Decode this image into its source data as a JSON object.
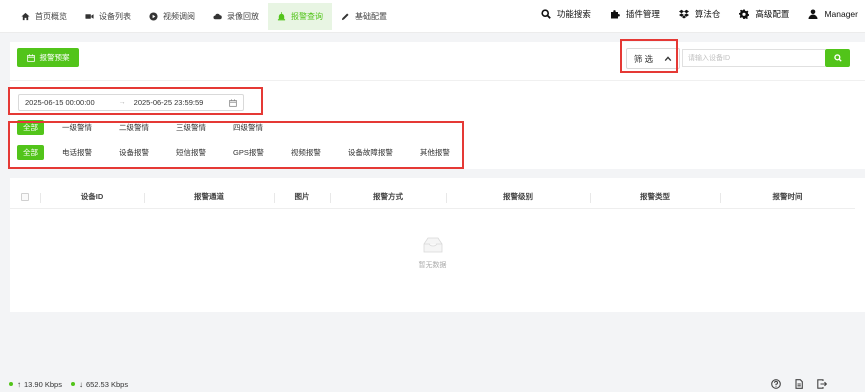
{
  "nav": {
    "items": [
      {
        "label": "首页概览",
        "icon": "home-icon"
      },
      {
        "label": "设备列表",
        "icon": "camera-icon"
      },
      {
        "label": "视频调阅",
        "icon": "video-icon"
      },
      {
        "label": "录像回放",
        "icon": "cloud-icon"
      },
      {
        "label": "报警查询",
        "icon": "alarm-icon"
      },
      {
        "label": "基础配置",
        "icon": "edit-icon"
      }
    ],
    "active": "报警查询"
  },
  "tools": {
    "function_search": "功能搜索",
    "plugin_manage": "插件管理",
    "algorithm_store": "算法仓",
    "advanced_config": "高级配置",
    "user": "Manager"
  },
  "toolbar": {
    "scheme_label": "报警预案",
    "filter_label": "筛 选",
    "search_placeholder": "请输入设备ID"
  },
  "date_range": {
    "start": "2025-06-15 00:00:00",
    "separator": "→",
    "end": "2025-06-25 23:59:59"
  },
  "level_filters": [
    "全部",
    "一级警情",
    "二级警情",
    "三级警情",
    "四级警情"
  ],
  "type_filters": [
    "全部",
    "电话报警",
    "设备报警",
    "短信报警",
    "GPS报警",
    "视频报警",
    "设备故障报警",
    "其他报警"
  ],
  "table": {
    "columns": [
      "设备ID",
      "报警通道",
      "图片",
      "报警方式",
      "报警级别",
      "报警类型",
      "报警时间"
    ],
    "empty_text": "暂无数据"
  },
  "status": {
    "upload": "13.90 Kbps",
    "download": "652.53 Kbps"
  },
  "colors": {
    "accent": "#52c41a",
    "highlight": "#e53935"
  }
}
